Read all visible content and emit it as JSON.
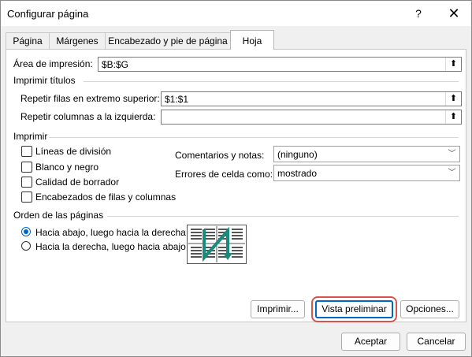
{
  "window": {
    "title": "Configurar página",
    "help_icon": "question-mark-icon",
    "close_icon": "close-icon"
  },
  "tabs": [
    {
      "label": "Página",
      "active": false
    },
    {
      "label": "Márgenes",
      "active": false
    },
    {
      "label": "Encabezado y pie de página",
      "active": false
    },
    {
      "label": "Hoja",
      "active": true
    }
  ],
  "print_area": {
    "label": "Área de impresión:",
    "value": "$B:$G"
  },
  "print_titles": {
    "section": "Imprimir títulos",
    "rows_label": "Repetir filas en extremo superior:",
    "rows_value": "$1:$1",
    "cols_label": "Repetir columnas a la izquierda:",
    "cols_value": ""
  },
  "print": {
    "section": "Imprimir",
    "checkboxes": [
      {
        "label": "Líneas de división",
        "checked": false
      },
      {
        "label": "Blanco y negro",
        "checked": false
      },
      {
        "label": "Calidad de borrador",
        "checked": false
      },
      {
        "label": "Encabezados de filas y columnas",
        "checked": false
      }
    ],
    "comments_label": "Comentarios y notas:",
    "comments_value": "(ninguno)",
    "errors_label": "Errores de celda como:",
    "errors_value": "mostrado"
  },
  "page_order": {
    "section": "Orden de las páginas",
    "options": [
      {
        "label": "Hacia abajo, luego hacia la derecha",
        "selected": true
      },
      {
        "label": "Hacia la derecha, luego hacia abajo",
        "selected": false
      }
    ]
  },
  "buttons": {
    "print": "Imprimir...",
    "preview": "Vista preliminar",
    "options": "Opciones...",
    "accept": "Aceptar",
    "cancel": "Cancelar"
  },
  "colors": {
    "accent": "#0067c0",
    "highlight_box": "#d9534f",
    "diagram_arrow": "#1a8a7a"
  }
}
